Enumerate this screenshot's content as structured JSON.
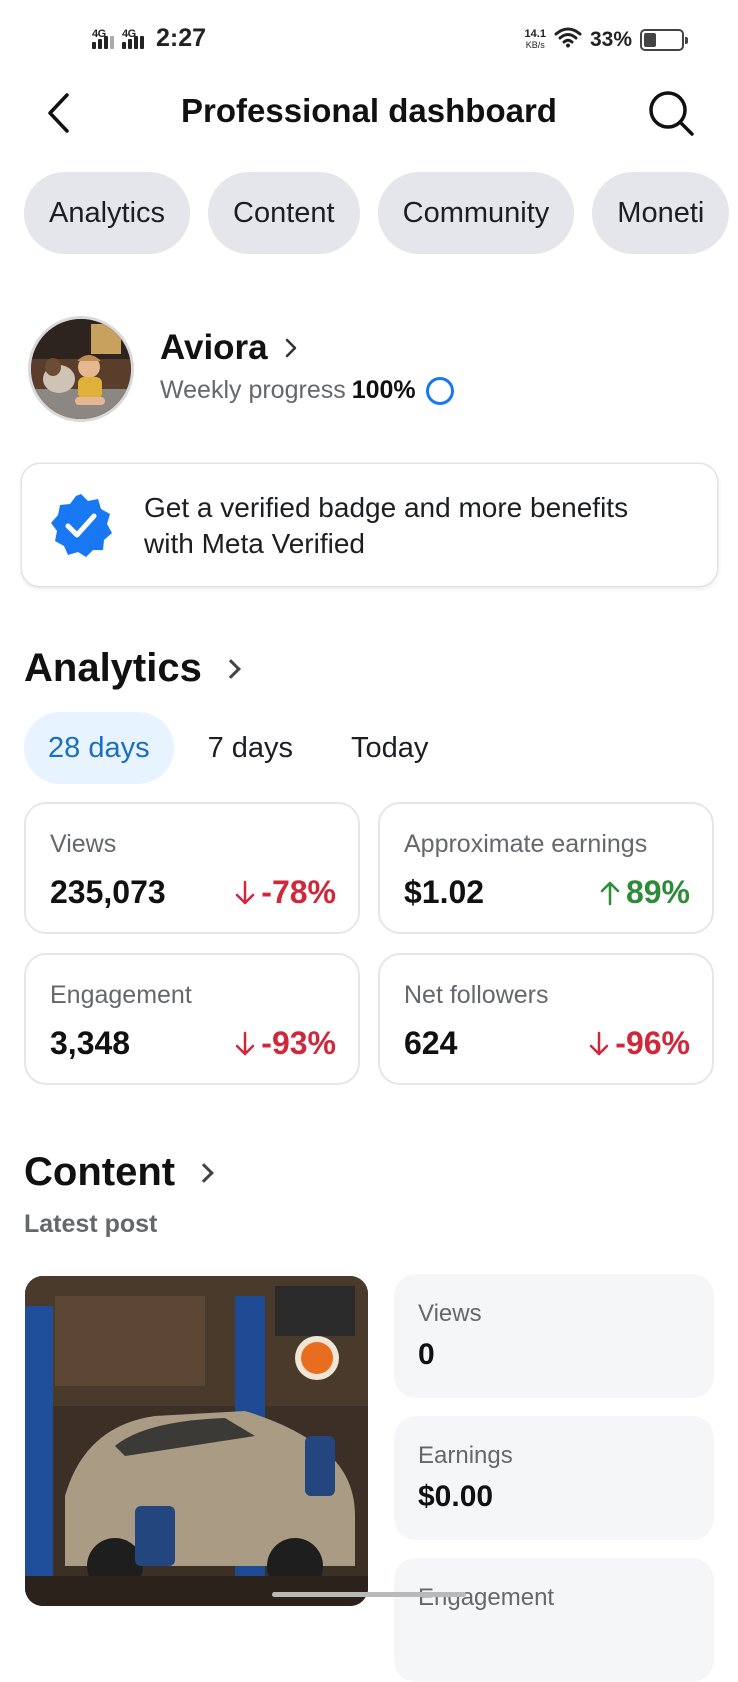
{
  "status_bar": {
    "net1": "4G",
    "net2": "4G",
    "time": "2:27",
    "speed_value": "14.1",
    "speed_unit": "KB/s",
    "battery_pct": "33%",
    "battery_level": 0.33
  },
  "header": {
    "title": "Professional dashboard",
    "back_icon": "back-arrow-icon",
    "search_icon": "search-icon"
  },
  "tabs": [
    {
      "label": "Analytics"
    },
    {
      "label": "Content"
    },
    {
      "label": "Community"
    },
    {
      "label": "Moneti"
    }
  ],
  "profile": {
    "name": "Aviora",
    "progress_label": "Weekly progress",
    "progress_value": "100%",
    "progress_fraction": 1.0
  },
  "verified_card": {
    "text": "Get a verified badge and more benefits with Meta Verified",
    "icon": "verified-badge-icon"
  },
  "analytics": {
    "title": "Analytics",
    "ranges": [
      {
        "label": "28 days",
        "active": true
      },
      {
        "label": "7 days",
        "active": false
      },
      {
        "label": "Today",
        "active": false
      }
    ],
    "cards": [
      {
        "label": "Views",
        "value": "235,073",
        "change": "-78%",
        "direction": "down"
      },
      {
        "label": "Approximate earnings",
        "value": "$1.02",
        "change": "89%",
        "direction": "up"
      },
      {
        "label": "Engagement",
        "value": "3,348",
        "change": "-93%",
        "direction": "down"
      },
      {
        "label": "Net followers",
        "value": "624",
        "change": "-96%",
        "direction": "down"
      }
    ]
  },
  "content": {
    "title": "Content",
    "subtitle": "Latest post",
    "stats": [
      {
        "label": "Views",
        "value": "0"
      },
      {
        "label": "Earnings",
        "value": "$0.00"
      },
      {
        "label": "Engagement",
        "value": ""
      }
    ]
  },
  "colors": {
    "accent": "#1877f2",
    "negative": "#d0283a",
    "positive": "#2e8b3a",
    "chip_bg": "#e4e6eb"
  }
}
